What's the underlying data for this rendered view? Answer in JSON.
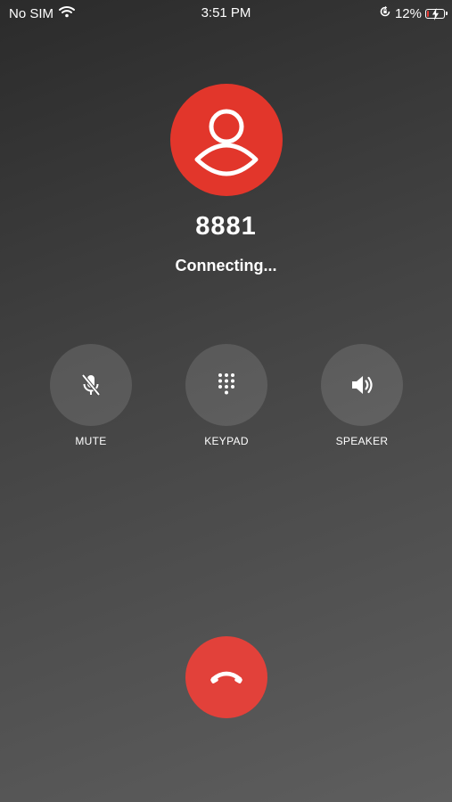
{
  "status_bar": {
    "carrier": "No SIM",
    "time": "3:51 PM",
    "battery_percent": "12%",
    "battery_level": 0.12,
    "icons": [
      "wifi-icon",
      "orientation-lock-icon",
      "battery-charging-icon"
    ]
  },
  "call": {
    "number": "8881",
    "status": "Connecting..."
  },
  "controls": {
    "mute_label": "MUTE",
    "keypad_label": "KEYPAD",
    "speaker_label": "SPEAKER"
  },
  "icons": {
    "avatar": "person-icon",
    "mute": "microphone-off-icon",
    "keypad": "dialpad-icon",
    "speaker": "speaker-icon",
    "end_call": "hang-up-icon"
  },
  "colors": {
    "avatar_bg": "#e2362b",
    "end_call_bg": "#e2413a",
    "control_bg": "rgba(255,255,255,0.12)",
    "battery_low": "#e53935"
  }
}
